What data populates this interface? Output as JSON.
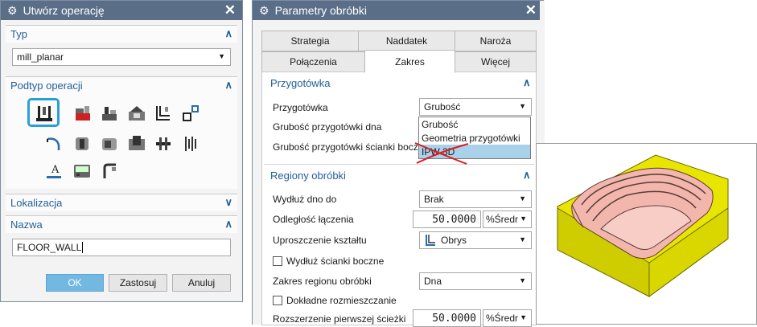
{
  "dialog1": {
    "title": "Utwórz operację",
    "type_section": {
      "label": "Typ",
      "value": "mill_planar"
    },
    "subtype_section": {
      "label": "Podtyp operacji"
    },
    "location_section": {
      "label": "Lokalizacja"
    },
    "name_section": {
      "label": "Nazwa",
      "value": "FLOOR_WALL"
    },
    "buttons": {
      "ok": "OK",
      "apply": "Zastosuj",
      "cancel": "Anuluj"
    }
  },
  "dialog2": {
    "title": "Parametry obróbki",
    "tabs_row1": [
      "Strategia",
      "Naddatek",
      "Naroża"
    ],
    "tabs_row2": [
      "Połączenia",
      "Zakres",
      "Więcej"
    ],
    "active_tab": "Zakres",
    "blank_section": {
      "label": "Przygotówka",
      "field_label": "Przygotówka",
      "field_value": "Grubość",
      "floor_label": "Grubość przygotówki dna",
      "wall_label": "Grubość przygotówki ścianki boczn"
    },
    "dropdown_options": [
      "Grubość",
      "Geometria przygotówki",
      "IPW 3D"
    ],
    "regions_section": {
      "label": "Regiony obróbki",
      "extend_floor_label": "Wydłuż dno do",
      "extend_floor_value": "Brak",
      "merge_distance_label": "Odległość łączenia",
      "merge_distance_value": "50.0000",
      "merge_distance_unit": "%Średr",
      "simplify_label": "Uproszczenie kształtu",
      "simplify_value": "Obrys",
      "extend_walls_label": "Wydłuż ścianki boczne",
      "region_extent_label": "Zakres regionu obróbki",
      "region_extent_value": "Dna",
      "precise_label": "Dokładne rozmieszczanie",
      "first_path_label": "Rozszerzenie pierwszej ścieżki",
      "first_path_value": "50.0000",
      "first_path_unit": "%Średr"
    }
  },
  "colors": {
    "titlebar": "#5a6f87",
    "section_text": "#1f5f97",
    "selection": "#2a9fd6",
    "ok_button": "#73b8e1",
    "dropdown_highlight": "#a9d2ea",
    "strike": "#e0191f",
    "part_yellow": "#e8e600",
    "part_pink": "#f2b6ad"
  },
  "icons": [
    "gear-icon",
    "close-icon",
    "chevron-up-icon",
    "chevron-down-icon",
    "dropdown-arrow-icon",
    "operation-subtype-icon",
    "outline-icon",
    "part-3d-preview"
  ]
}
